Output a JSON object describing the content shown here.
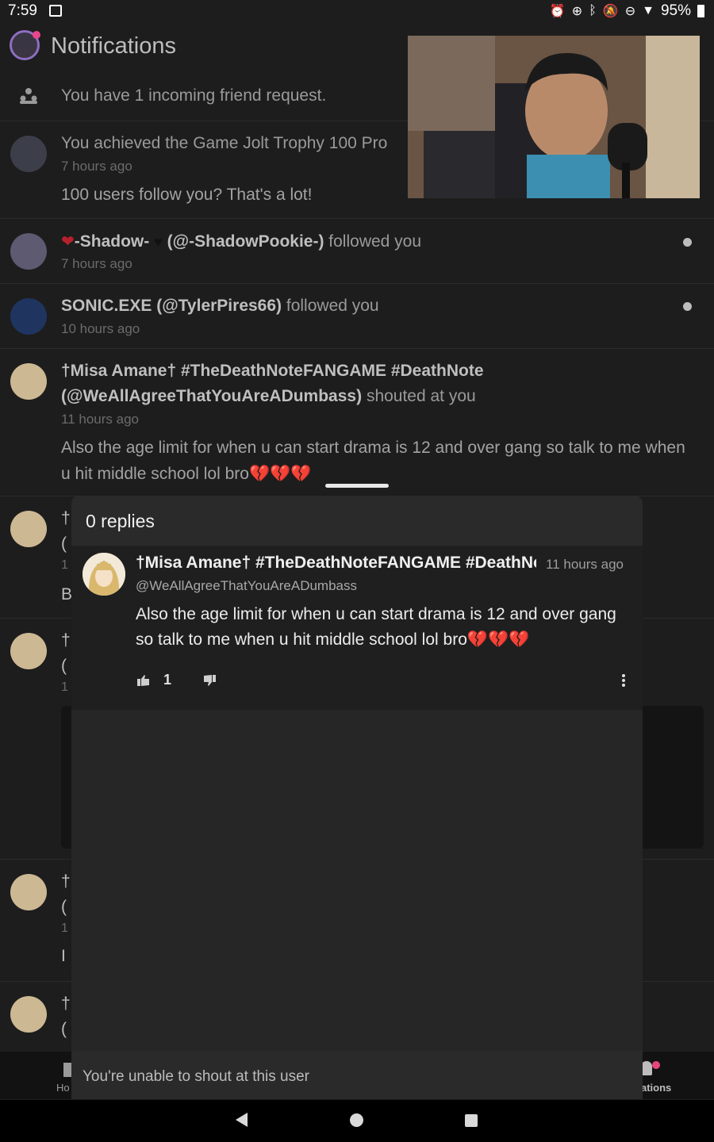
{
  "status_bar": {
    "time": "7:59",
    "battery": "95%"
  },
  "header": {
    "title": "Notifications"
  },
  "notifications": [
    {
      "text": "You have 1 incoming friend request."
    },
    {
      "text": "You achieved the Game Jolt Trophy 100 Pro",
      "time": "7 hours ago",
      "body": "100 users follow you? That's a lot!"
    },
    {
      "name": "-Shadow-",
      "handle": "(@-ShadowPookie-)",
      "action": "followed you",
      "time": "7 hours ago"
    },
    {
      "name": "SONIC.EXE (@TylerPires66)",
      "action": "followed you",
      "time": "10 hours ago"
    },
    {
      "name_line1": "†Misa Amane† #TheDeathNoteFANGAME #DeathNote",
      "name_line2": "(@WeAllAgreeThatYouAreADumbass)",
      "action": "shouted at you",
      "time": "11 hours ago",
      "body": "Also the age limit for when u can start drama is 12 and over gang so talk to me when u hit middle school lol bro"
    }
  ],
  "partial_rows": {
    "r1": [
      "†I",
      "(",
      "1",
      "B"
    ],
    "r2": [
      "†I",
      "(",
      "1"
    ],
    "r3": [
      "†I",
      "(",
      "1",
      "I"
    ],
    "r4": [
      "†I",
      "("
    ]
  },
  "modal": {
    "title": "0 replies",
    "post": {
      "author": "†Misa Amane† #TheDeathNoteFANGAME #DeathNote",
      "time": "11 hours ago",
      "handle": "@WeAllAgreeThatYouAreADumbass",
      "body": "Also the age limit for when u can start drama is 12 and over gang so talk to me when u hit middle school lol bro",
      "hearts": "💔💔💔",
      "likes": "1"
    },
    "footer": "You're unable to shout at this user"
  },
  "bottom_nav": {
    "home_label": "Ho",
    "notifications_label": "ations"
  },
  "colors": {
    "background": "#1d1d1d",
    "modal": "#2a2a2a",
    "accent": "#8e6ec0",
    "heart": "#d4212f"
  }
}
